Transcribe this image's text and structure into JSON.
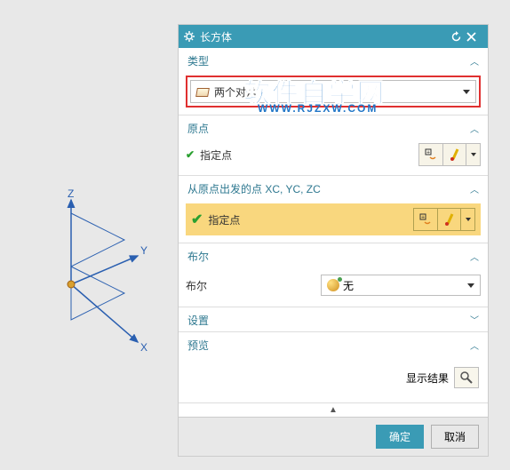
{
  "title": "长方体",
  "sections": {
    "type": {
      "header": "类型",
      "selected": "两个对角"
    },
    "origin": {
      "header": "原点",
      "label": "指定点"
    },
    "from_origin": {
      "header": "从原点出发的点 XC, YC, ZC",
      "label": "指定点"
    },
    "boolean": {
      "header": "布尔",
      "label": "布尔",
      "value": "无"
    },
    "settings": {
      "header": "设置"
    },
    "preview": {
      "header": "预览",
      "show_result": "显示结果"
    }
  },
  "footer": {
    "ok": "确定",
    "cancel": "取消"
  },
  "watermark": {
    "main": "软件自学网",
    "sub": "WWW.RJZXW.COM"
  },
  "axes": {
    "x": "X",
    "y": "Y",
    "z": "Z"
  }
}
